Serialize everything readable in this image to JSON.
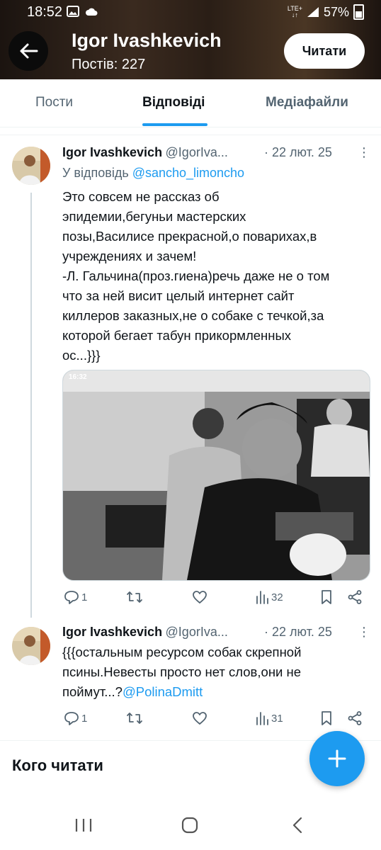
{
  "status_bar": {
    "time": "18:52",
    "network": "LTE+",
    "battery": "57%"
  },
  "header": {
    "name": "Igor Ivashkevich",
    "posts_count": "Постів: 227",
    "follow_label": "Читати"
  },
  "tabs": [
    {
      "label": "Пости",
      "active": false
    },
    {
      "label": "Відповіді",
      "active": true
    },
    {
      "label": "Медіафайли",
      "active": false
    }
  ],
  "tweets": [
    {
      "name": "Igor Ivashkevich",
      "handle": "@IgorIva...",
      "date": "· 22 лют. 25",
      "reply_prefix": "У відповідь ",
      "reply_to": "@sancho_limoncho",
      "text": "Это совсем не рассказ об\nэпидемии,бегуньи мастерских\nпозы,Василисе прекрасной,о поварихах,в\nучреждениях и зачем!\n-Л. Гальчина(проз.гиена)речь даже не о том\nчто за ней висит целый интернет сайт\nкиллеров заказных,не о собаке с течкой,за\nкоторой бегает табун прикормленных\nос...}}}",
      "media_timestamp": "16:32",
      "replies": "1",
      "views": "32"
    },
    {
      "name": "Igor Ivashkevich",
      "handle": "@IgorIva...",
      "date": "· 22 лют. 25",
      "text": "{{{остальным ресурсом собак скрепной\nпсины.Невесты просто нет слов,они не\nпоймут...?",
      "mention": "@PolinaDmitt",
      "replies": "1",
      "views": "31"
    }
  ],
  "who_to_follow": "Кого читати",
  "colors": {
    "accent": "#1d9bf0",
    "text": "#0f1419",
    "secondary": "#536471"
  }
}
